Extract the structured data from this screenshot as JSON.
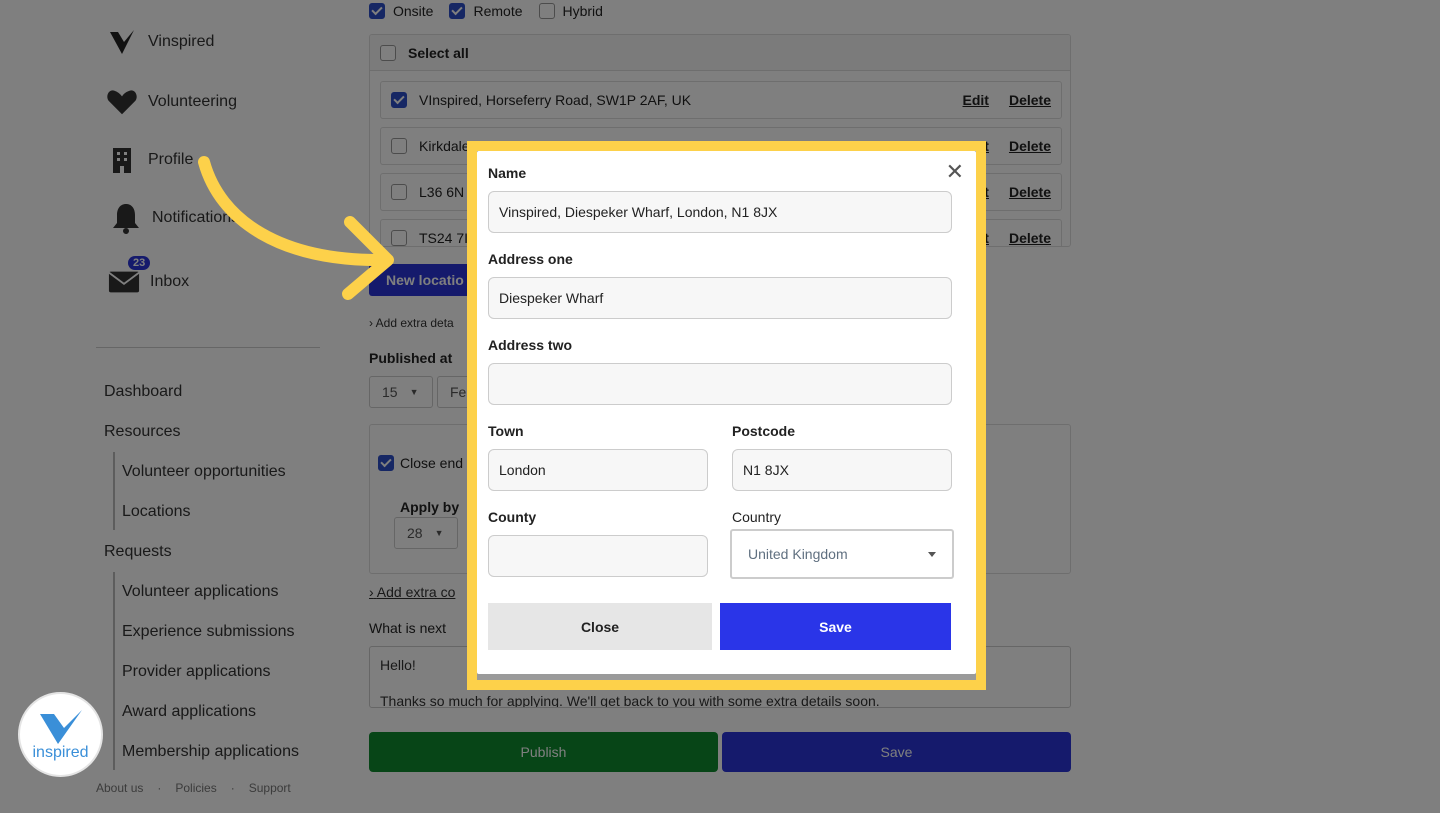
{
  "sidebar": {
    "brand": "Vinspired",
    "nav": [
      {
        "label": "Volunteering",
        "icon": "handshake-heart-icon"
      },
      {
        "label": "Profile",
        "icon": "building-icon"
      },
      {
        "label": "Notifications",
        "icon": "bell-icon"
      },
      {
        "label": "Inbox",
        "icon": "mail-icon",
        "badge": "23"
      }
    ],
    "menu": {
      "dashboard": "Dashboard",
      "resources": "Resources",
      "resources_items": [
        "Volunteer opportunities",
        "Locations"
      ],
      "requests": "Requests",
      "requests_items": [
        "Volunteer applications",
        "Experience submissions",
        "Provider applications",
        "Award applications",
        "Membership applications"
      ]
    },
    "footer": [
      "About us",
      "·",
      "Policies",
      "·",
      "Support"
    ],
    "logo_text": "inspired"
  },
  "main": {
    "work_types": [
      {
        "label": "Onsite",
        "checked": true
      },
      {
        "label": "Remote",
        "checked": true
      },
      {
        "label": "Hybrid",
        "checked": false
      }
    ],
    "select_all": "Select all",
    "locations": [
      {
        "text": "VInspired, Horseferry Road, SW1P 2AF, UK",
        "checked": true
      },
      {
        "text": "Kirkdale",
        "checked": false
      },
      {
        "text": "L36 6N",
        "checked": false
      },
      {
        "text": "TS24 7I",
        "checked": false
      }
    ],
    "edit_label": "Edit",
    "delete_label": "Delete",
    "new_location": "New locatio",
    "add_extra_details": "Add extra deta",
    "published_at": "Published at",
    "day_value": "15",
    "month_value": "Fe",
    "close_end": "Close end",
    "apply_by": "Apply by",
    "apply_day": "28",
    "add_extra_co": "Add extra co",
    "what_is_next": "What is next",
    "textarea_line1": "Hello!",
    "textarea_line2": "Thanks so much for applying. We'll get back to you with some extra details soon.",
    "publish": "Publish",
    "save": "Save"
  },
  "modal": {
    "name_label": "Name",
    "name_value": "Vinspired, Diespeker Wharf, London, N1 8JX",
    "address_one_label": "Address one",
    "address_one_value": "Diespeker Wharf",
    "address_two_label": "Address two",
    "address_two_value": "",
    "town_label": "Town",
    "town_value": "London",
    "postcode_label": "Postcode",
    "postcode_value": "N1 8JX",
    "county_label": "County",
    "county_value": "",
    "country_label": "Country",
    "country_value": "United Kingdom",
    "close_button": "Close",
    "save_button": "Save",
    "close_icon": "✕"
  },
  "colors": {
    "highlight": "#fdd14a",
    "primary": "#2a35e8",
    "publish": "#0f8a2e",
    "arrow": "#fdd14a"
  }
}
